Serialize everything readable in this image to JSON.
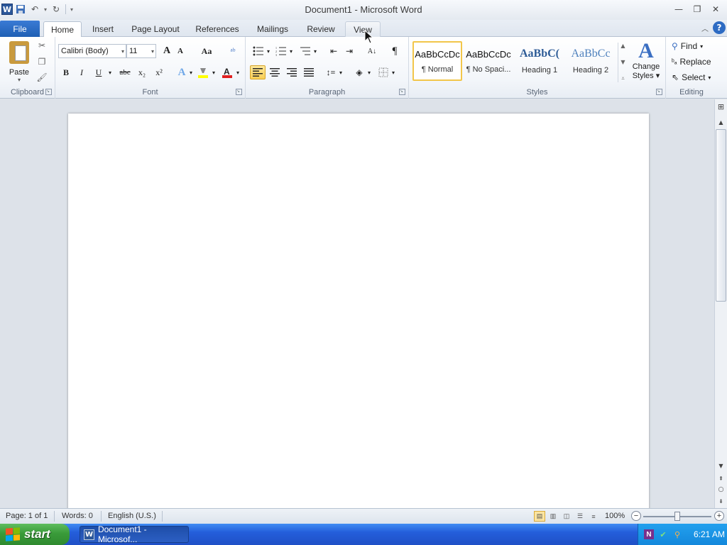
{
  "window": {
    "title": "Document1  -  Microsoft Word",
    "app_icon_letter": "W"
  },
  "tabs": {
    "file": "File",
    "items": [
      "Home",
      "Insert",
      "Page Layout",
      "References",
      "Mailings",
      "Review",
      "View"
    ],
    "active": "Home",
    "hovered": "View"
  },
  "clipboard": {
    "group_label": "Clipboard",
    "paste_label": "Paste"
  },
  "font": {
    "group_label": "Font",
    "font_name": "Calibri (Body)",
    "font_size": "11",
    "grow_label": "A",
    "shrink_label": "A",
    "case_label": "Aa",
    "bold": "B",
    "italic": "I",
    "underline": "U",
    "strike": "abc",
    "subscript": "x₂",
    "superscript": "x²",
    "font_color_label": "A"
  },
  "paragraph": {
    "group_label": "Paragraph",
    "pilcrow": "¶"
  },
  "styles": {
    "group_label": "Styles",
    "items": [
      {
        "sample": "AaBbCcDc",
        "name": "¶ Normal"
      },
      {
        "sample": "AaBbCcDc",
        "name": "¶ No Spaci..."
      },
      {
        "sample": "AaBbC(",
        "name": "Heading 1"
      },
      {
        "sample": "AaBbCc",
        "name": "Heading 2"
      }
    ],
    "change_styles_line1": "Change",
    "change_styles_line2": "Styles"
  },
  "editing": {
    "group_label": "Editing",
    "find": "Find",
    "replace": "Replace",
    "select": "Select"
  },
  "statusbar": {
    "page": "Page: 1 of 1",
    "words": "Words: 0",
    "language": "English (U.S.)",
    "zoom": "100%",
    "zoom_percent": 100
  },
  "taskbar": {
    "start": "start",
    "task_item": "Document1 - Microsof...",
    "clock": "6:21 AM"
  },
  "colors": {
    "file_tab": "#2b6cc4",
    "selected_style_border": "#f2c64a",
    "taskbar_blue": "#245edb",
    "start_green": "#3a9b3a"
  }
}
